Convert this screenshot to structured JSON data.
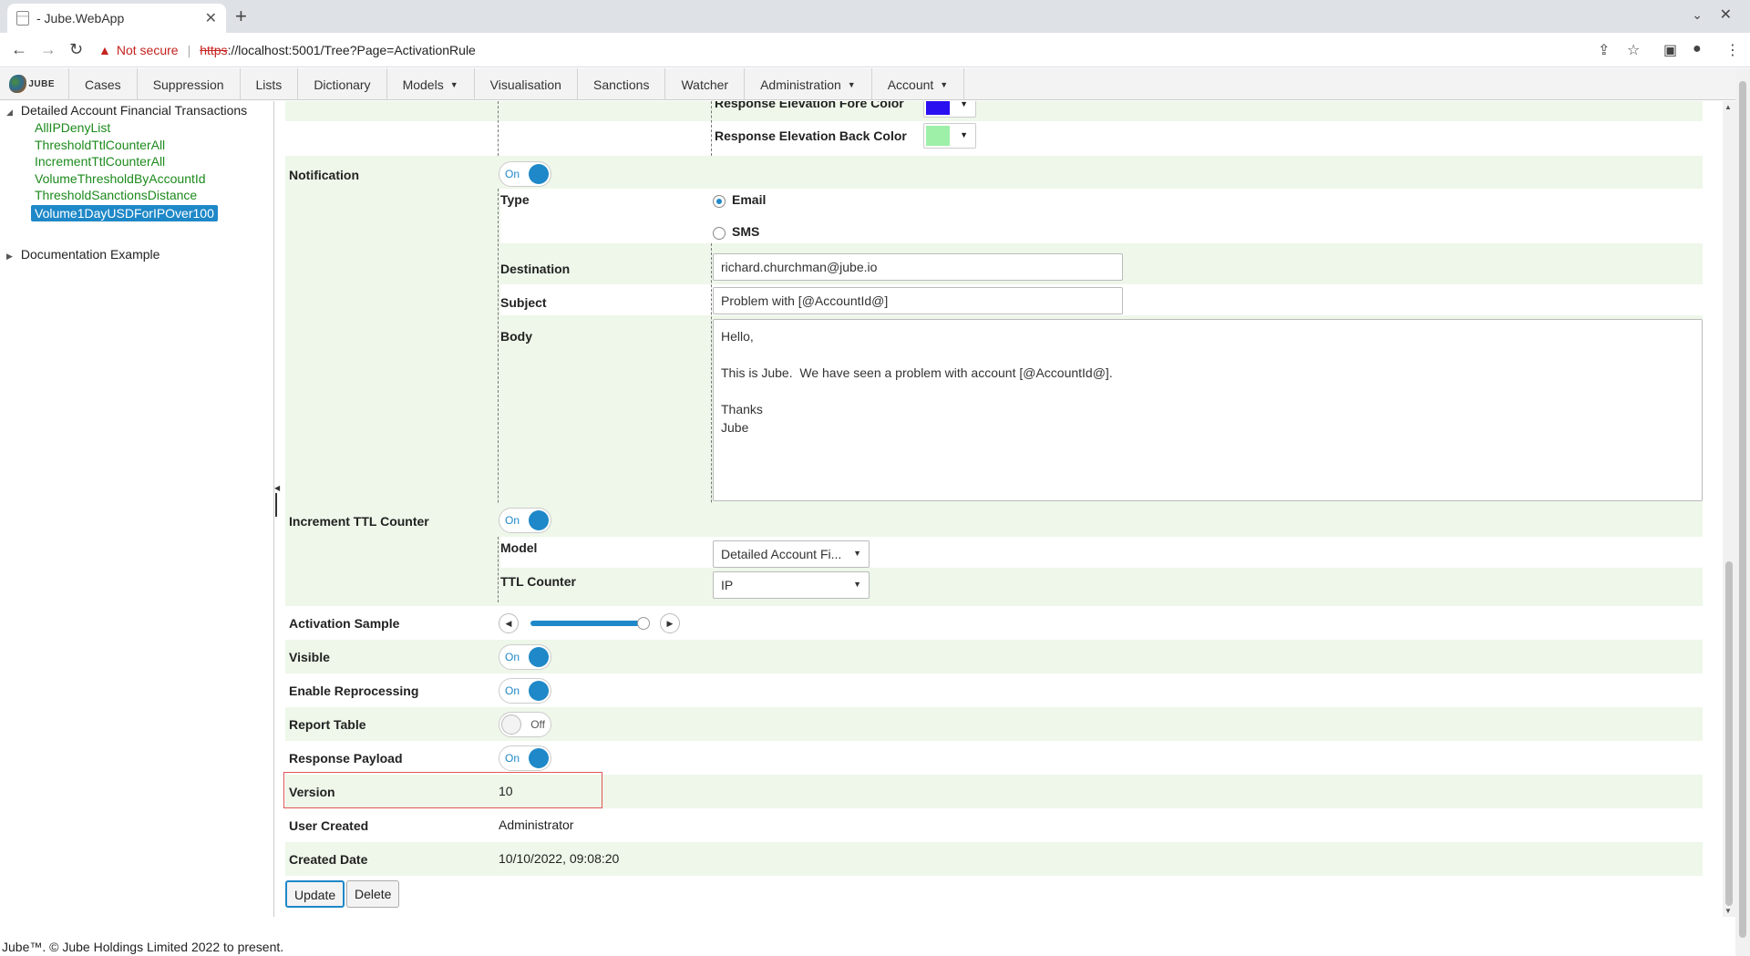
{
  "browser": {
    "tab_title": "- Jube.WebApp",
    "not_secure": "Not secure",
    "url_scheme": "https",
    "url_host": "://localhost",
    "url_rest": ":5001/Tree?Page=ActivationRule"
  },
  "nav": {
    "items": [
      {
        "label": "Cases",
        "dropdown": false
      },
      {
        "label": "Suppression",
        "dropdown": false
      },
      {
        "label": "Lists",
        "dropdown": false
      },
      {
        "label": "Dictionary",
        "dropdown": false
      },
      {
        "label": "Models",
        "dropdown": true
      },
      {
        "label": "Visualisation",
        "dropdown": false
      },
      {
        "label": "Sanctions",
        "dropdown": false
      },
      {
        "label": "Watcher",
        "dropdown": false
      },
      {
        "label": "Administration",
        "dropdown": true
      },
      {
        "label": "Account",
        "dropdown": true
      }
    ],
    "logo_text": "JUBE"
  },
  "tree": {
    "root": "Detailed Account Financial Transactions",
    "children": [
      "AllIPDenyList",
      "ThresholdTtlCounterAll",
      "IncrementTtlCounterAll",
      "VolumeThresholdByAccountId",
      "ThresholdSanctionsDistance",
      "Volume1DayUSDForIPOver100"
    ],
    "selected": "Volume1DayUSDForIPOver100",
    "second_root": "Documentation Example"
  },
  "form": {
    "response_elevation_fore_color_label": "Response Elevation Fore Color",
    "response_elevation_fore_color": "#2a10f0",
    "response_elevation_back_color_label": "Response Elevation Back Color",
    "response_elevation_back_color": "#9ef0a8",
    "notification_label": "Notification",
    "notification_state": "On",
    "type_label": "Type",
    "type_options": [
      "Email",
      "SMS"
    ],
    "type_selected": "Email",
    "destination_label": "Destination",
    "destination_value": "richard.churchman@jube.io",
    "subject_label": "Subject",
    "subject_value": "Problem with [@AccountId@]",
    "body_label": "Body",
    "body_value": "Hello,\n\nThis is Jube.  We have seen a problem with account [@AccountId@].\n\nThanks\nJube",
    "increment_ttl_label": "Increment TTL Counter",
    "increment_ttl_state": "On",
    "model_label": "Model",
    "model_value": "Detailed Account Fi...",
    "ttl_counter_label": "TTL Counter",
    "ttl_counter_value": "IP",
    "activation_sample_label": "Activation Sample",
    "activation_sample_fraction": 0.95,
    "visible_label": "Visible",
    "visible_state": "On",
    "enable_reprocessing_label": "Enable Reprocessing",
    "enable_reprocessing_state": "On",
    "report_table_label": "Report Table",
    "report_table_state": "Off",
    "response_payload_label": "Response Payload",
    "response_payload_state": "On",
    "version_label": "Version",
    "version_value": "10",
    "user_created_label": "User Created",
    "user_created_value": "Administrator",
    "created_date_label": "Created Date",
    "created_date_value": "10/10/2022, 09:08:20",
    "update_button": "Update",
    "delete_button": "Delete"
  },
  "footer": "Jube™. © Jube Holdings Limited 2022 to present."
}
